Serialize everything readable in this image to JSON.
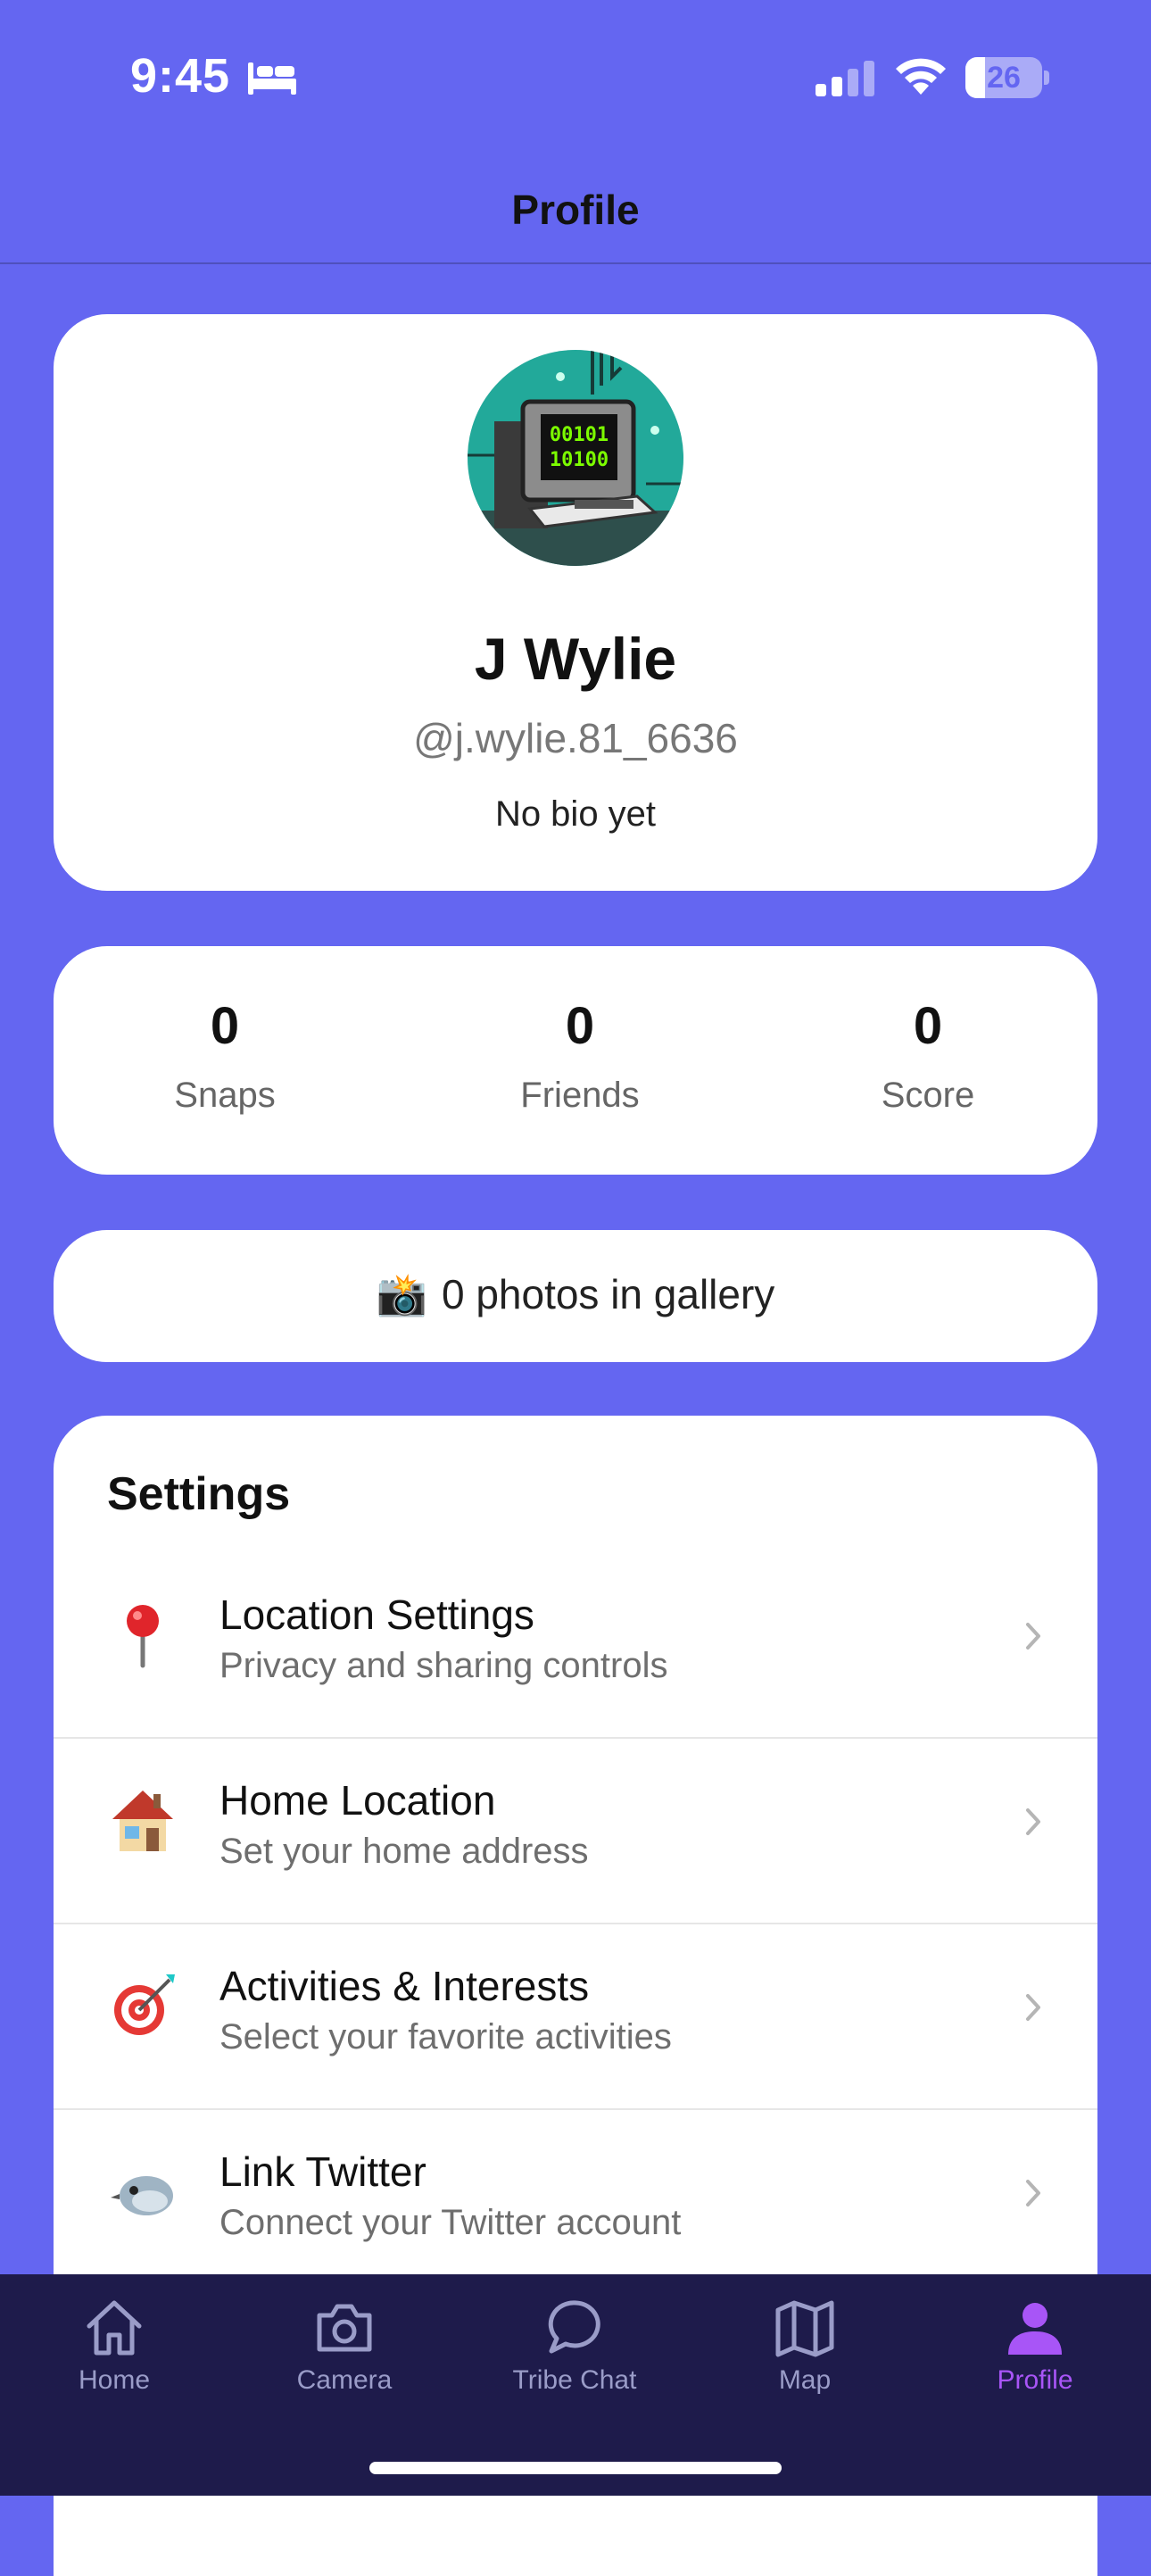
{
  "status_bar": {
    "time": "9:45",
    "battery": "26",
    "battery_level": 0.26
  },
  "header": {
    "title": "Profile"
  },
  "profile": {
    "name": "J Wylie",
    "username": "@j.wylie.81_6636",
    "bio": "No bio yet",
    "avatar_icon": "computer-terminal-avatar",
    "avatar_screen_text": [
      "00101",
      "10100"
    ]
  },
  "stats": [
    {
      "value": "0",
      "label": "Snaps"
    },
    {
      "value": "0",
      "label": "Friends"
    },
    {
      "value": "0",
      "label": "Score"
    }
  ],
  "gallery": {
    "emoji": "📸",
    "text": "0 photos in gallery"
  },
  "settings": {
    "title": "Settings",
    "items": [
      {
        "icon": "round-pushpin-icon",
        "title": "Location Settings",
        "subtitle": "Privacy and sharing controls"
      },
      {
        "icon": "house-icon",
        "title": "Home Location",
        "subtitle": "Set your home address"
      },
      {
        "icon": "bullseye-dart-icon",
        "title": "Activities & Interests",
        "subtitle": "Select your favorite activities"
      },
      {
        "icon": "bird-icon",
        "title": "Link Twitter",
        "subtitle": "Connect your Twitter account"
      }
    ]
  },
  "tabs": [
    {
      "label": "Home",
      "icon": "home-icon",
      "active": false
    },
    {
      "label": "Camera",
      "icon": "camera-icon",
      "active": false
    },
    {
      "label": "Tribe Chat",
      "icon": "chat-bubble-icon",
      "active": false
    },
    {
      "label": "Map",
      "icon": "map-icon",
      "active": false
    },
    {
      "label": "Profile",
      "icon": "person-icon",
      "active": true
    }
  ],
  "colors": {
    "background": "#6466f1",
    "tab_bar": "#1e1b4b",
    "tab_active": "#a855f7",
    "tab_inactive": "#9a9cc8"
  }
}
